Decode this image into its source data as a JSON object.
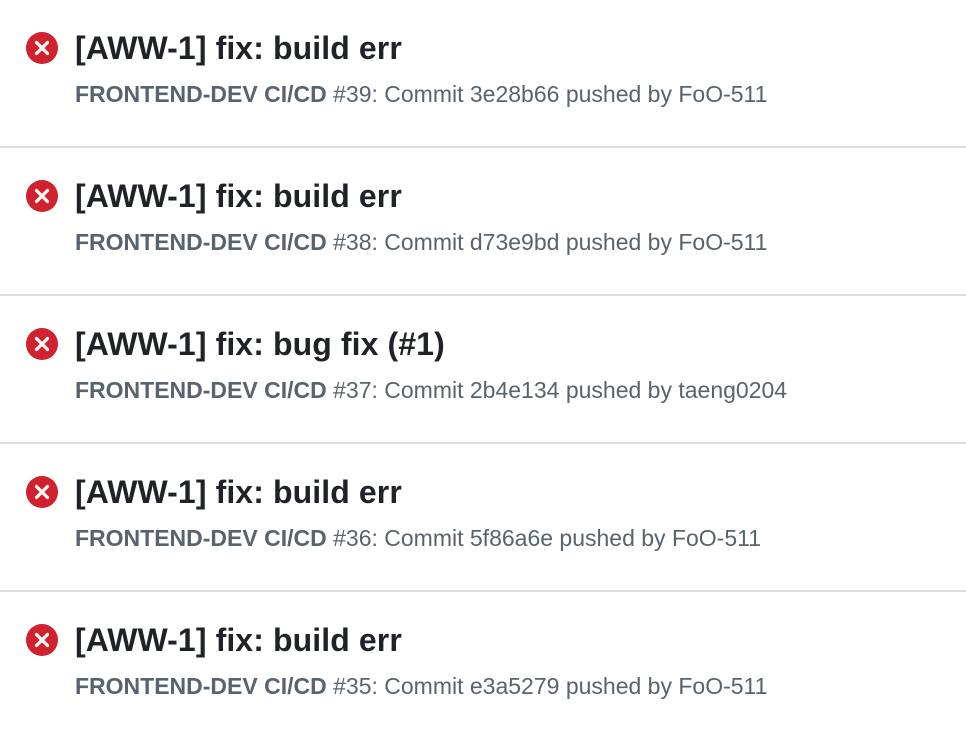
{
  "runs": [
    {
      "status": "failure",
      "status_icon": "x-circle-fill-icon",
      "title": "[AWW-1] fix: build err",
      "workflow": "FRONTEND-DEV CI/CD",
      "detail": " #39: Commit 3e28b66 pushed by FoO-511"
    },
    {
      "status": "failure",
      "status_icon": "x-circle-fill-icon",
      "title": "[AWW-1] fix: build err",
      "workflow": "FRONTEND-DEV CI/CD",
      "detail": " #38: Commit d73e9bd pushed by FoO-511"
    },
    {
      "status": "failure",
      "status_icon": "x-circle-fill-icon",
      "title": "[AWW-1] fix: bug fix (#1)",
      "workflow": "FRONTEND-DEV CI/CD",
      "detail": " #37: Commit 2b4e134 pushed by taeng0204"
    },
    {
      "status": "failure",
      "status_icon": "x-circle-fill-icon",
      "title": "[AWW-1] fix: build err",
      "workflow": "FRONTEND-DEV CI/CD",
      "detail": " #36: Commit 5f86a6e pushed by FoO-511"
    },
    {
      "status": "failure",
      "status_icon": "x-circle-fill-icon",
      "title": "[AWW-1] fix: build err",
      "workflow": "FRONTEND-DEV CI/CD",
      "detail": " #35: Commit e3a5279 pushed by FoO-511"
    }
  ],
  "colors": {
    "failure": "#cf222e",
    "title": "#1f2328",
    "meta": "#59636e",
    "divider": "#d8dee4"
  }
}
